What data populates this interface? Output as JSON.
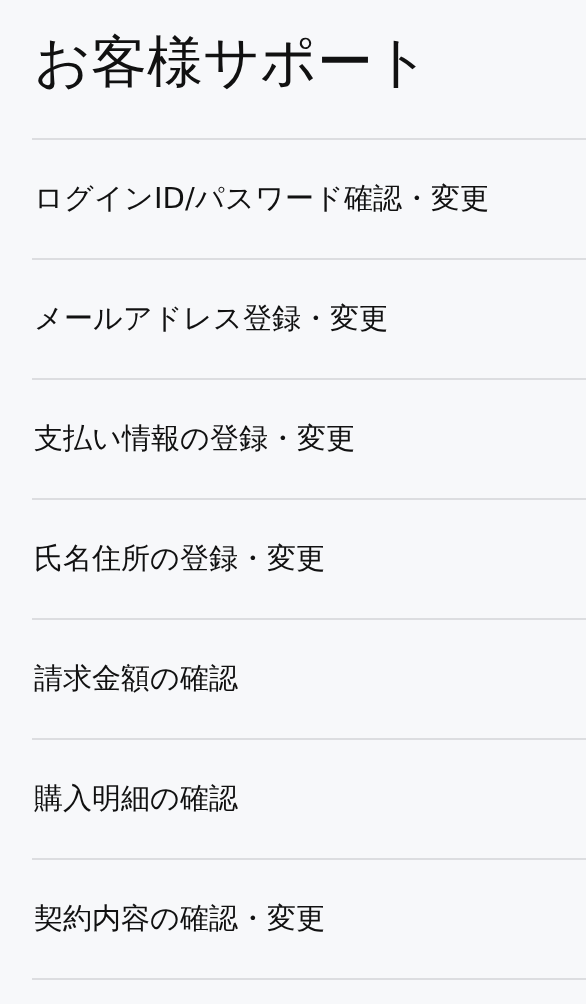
{
  "title": "お客様サポート",
  "items": [
    {
      "label": "ログインID/パスワード確認・変更"
    },
    {
      "label": "メールアドレス登録・変更"
    },
    {
      "label": "支払い情報の登録・変更"
    },
    {
      "label": "氏名住所の登録・変更"
    },
    {
      "label": "請求金額の確認"
    },
    {
      "label": "購入明細の確認"
    },
    {
      "label": "契約内容の確認・変更"
    }
  ]
}
